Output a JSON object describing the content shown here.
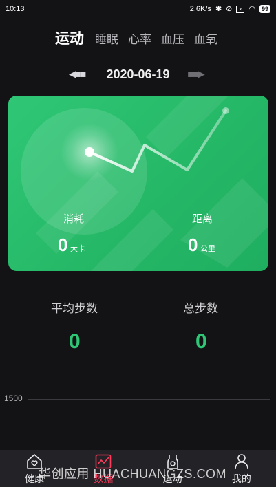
{
  "status_bar": {
    "time": "10:13",
    "speed": "2.6K/s",
    "bluetooth_icon": "bluetooth-icon",
    "mute_icon": "mute-icon",
    "battery": "99"
  },
  "tabs": [
    {
      "label": "运动",
      "active": true
    },
    {
      "label": "睡眠",
      "active": false
    },
    {
      "label": "心率",
      "active": false
    },
    {
      "label": "血压",
      "active": false
    },
    {
      "label": "血氧",
      "active": false
    }
  ],
  "date": {
    "value": "2020-06-19",
    "prev_icon": "arrow-left-icon",
    "next_icon": "arrow-right-icon"
  },
  "card": {
    "accent": "#2fc776",
    "consume": {
      "label": "消耗",
      "value": "0",
      "unit": "大卡"
    },
    "distance": {
      "label": "距离",
      "value": "0",
      "unit": "公里"
    }
  },
  "stats": {
    "avg_steps": {
      "label": "平均步数",
      "value": "0"
    },
    "total_steps": {
      "label": "总步数",
      "value": "0"
    }
  },
  "chart": {
    "y_tick": "1500"
  },
  "bottom_nav": [
    {
      "label": "健康",
      "icon": "heart-house-icon",
      "active": false
    },
    {
      "label": "数据",
      "icon": "data-chart-icon",
      "active": true
    },
    {
      "label": "运动",
      "icon": "runner-vest-icon",
      "active": false
    },
    {
      "label": "我的",
      "icon": "person-icon",
      "active": false
    }
  ],
  "watermark": "华创应用 HUACHUANGZS.COM",
  "colors": {
    "background": "#131316",
    "green": "#2fc776",
    "active_nav": "#ff3b5b"
  }
}
